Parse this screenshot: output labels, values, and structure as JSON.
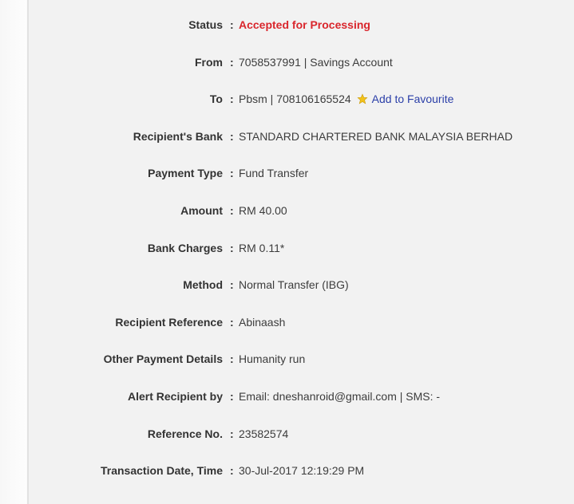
{
  "rows": [
    {
      "label": "Status",
      "value": "Accepted for Processing"
    },
    {
      "label": "From",
      "value": "7058537991 | Savings Account"
    },
    {
      "label": "To",
      "value": "Pbsm | 708106165524",
      "link": "Add to Favourite"
    },
    {
      "label": "Recipient's Bank",
      "value": "STANDARD CHARTERED BANK MALAYSIA BERHAD"
    },
    {
      "label": "Payment Type",
      "value": "Fund Transfer"
    },
    {
      "label": "Amount",
      "value": "RM 40.00"
    },
    {
      "label": "Bank Charges",
      "value": "RM 0.11*"
    },
    {
      "label": "Method",
      "value": "Normal Transfer (IBG)"
    },
    {
      "label": "Recipient Reference",
      "value": "Abinaash"
    },
    {
      "label": "Other Payment Details",
      "value": "Humanity run"
    },
    {
      "label": "Alert Recipient by",
      "value": "Email: dneshanroid@gmail.com | SMS: -"
    },
    {
      "label": "Reference No.",
      "value": "23582574"
    },
    {
      "label": "Transaction Date, Time",
      "value": "30-Jul-2017 12:19:29 PM"
    }
  ],
  "colon": ":",
  "icons": {
    "favourite": "star-icon"
  },
  "colors": {
    "status": "#d9262c",
    "link": "#2b3fa8"
  }
}
